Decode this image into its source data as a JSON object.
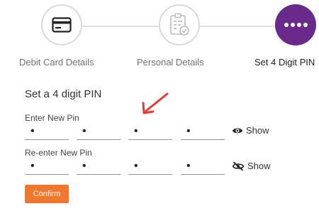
{
  "stepper": {
    "steps": [
      {
        "label": "Debit Card Details",
        "icon": "credit-card-icon",
        "state": "done"
      },
      {
        "label": "Personal Details",
        "icon": "clipboard-check-icon",
        "state": "done"
      },
      {
        "label": "Set 4 Digit PIN",
        "icon": "dots-icon",
        "state": "active"
      }
    ]
  },
  "form": {
    "title": "Set a 4 digit PIN",
    "new_pin": {
      "label": "Enter New Pin",
      "digits": [
        "•",
        "•",
        "•",
        "•"
      ],
      "toggle_label": "Show",
      "toggle_icon": "eye-icon"
    },
    "reenter_pin": {
      "label": "Re-enter New Pin",
      "digits": [
        "•",
        "•",
        "•",
        "•"
      ],
      "toggle_label": "Show",
      "toggle_icon": "eye-slash-icon"
    },
    "confirm_label": "Confirm"
  },
  "colors": {
    "accent": "#6a2a8c",
    "button": "#f0772e",
    "annotation": "#e53935"
  }
}
